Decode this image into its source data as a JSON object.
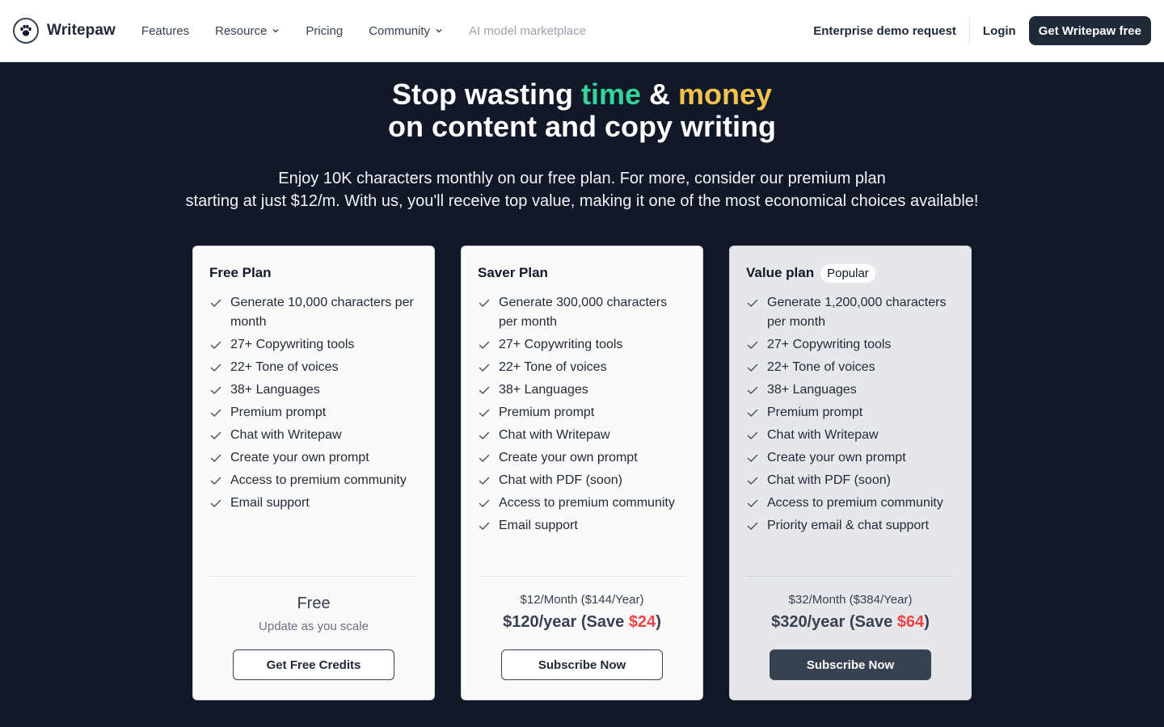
{
  "header": {
    "brand": "Writepaw",
    "nav": [
      {
        "label": "Features"
      },
      {
        "label": "Resource"
      },
      {
        "label": "Pricing"
      },
      {
        "label": "Community"
      },
      {
        "label": "AI model marketplace"
      }
    ],
    "enterprise": "Enterprise demo request",
    "login": "Login",
    "cta": "Get Writepaw free"
  },
  "hero": {
    "line1_a": "Stop wasting ",
    "line1_time": "time",
    "line1_amp": " & ",
    "line1_money": "money",
    "line2": "on content and copy writing",
    "sub1": "Enjoy 10K characters monthly on our free plan. For more, consider our premium plan",
    "sub2": "starting at just $12/m. With us, you'll receive top value, making it one of the most economical choices available!"
  },
  "colors": {
    "background": "#111827",
    "accent_time": "#34d399",
    "accent_money": "#f2c14e",
    "save_red": "#ef4444"
  },
  "plans": [
    {
      "title": "Free Plan",
      "features": [
        "Generate 10,000 characters per month",
        "27+ Copywriting tools",
        "22+ Tone of voices",
        "38+ Languages",
        "Premium prompt",
        "Chat with Writepaw",
        "Create your own prompt",
        "Access to premium community",
        "Email support"
      ],
      "price": "Free",
      "note": "Update as you scale",
      "button": "Get Free Credits"
    },
    {
      "title": "Saver Plan",
      "features": [
        "Generate 300,000 characters per month",
        "27+ Copywriting tools",
        "22+ Tone of voices",
        "38+ Languages",
        "Premium prompt",
        "Chat with Writepaw",
        "Create your own prompt",
        "Chat with PDF (soon)",
        "Access to premium community",
        "Email support"
      ],
      "monthly": "$12/Month ($144/Year)",
      "year_a": "$120/year (Save ",
      "year_save": "$24",
      "year_b": ")",
      "button": "Subscribe Now"
    },
    {
      "title": "Value plan",
      "badge": "Popular",
      "features": [
        "Generate 1,200,000 characters per month",
        "27+ Copywriting tools",
        "22+ Tone of voices",
        "38+ Languages",
        "Premium prompt",
        "Chat with Writepaw",
        "Create your own prompt",
        "Chat with PDF (soon)",
        "Access to premium community",
        "Priority email & chat support"
      ],
      "monthly": "$32/Month ($384/Year)",
      "year_a": "$320/year (Save ",
      "year_save": "$64",
      "year_b": ")",
      "button": "Subscribe Now"
    }
  ]
}
